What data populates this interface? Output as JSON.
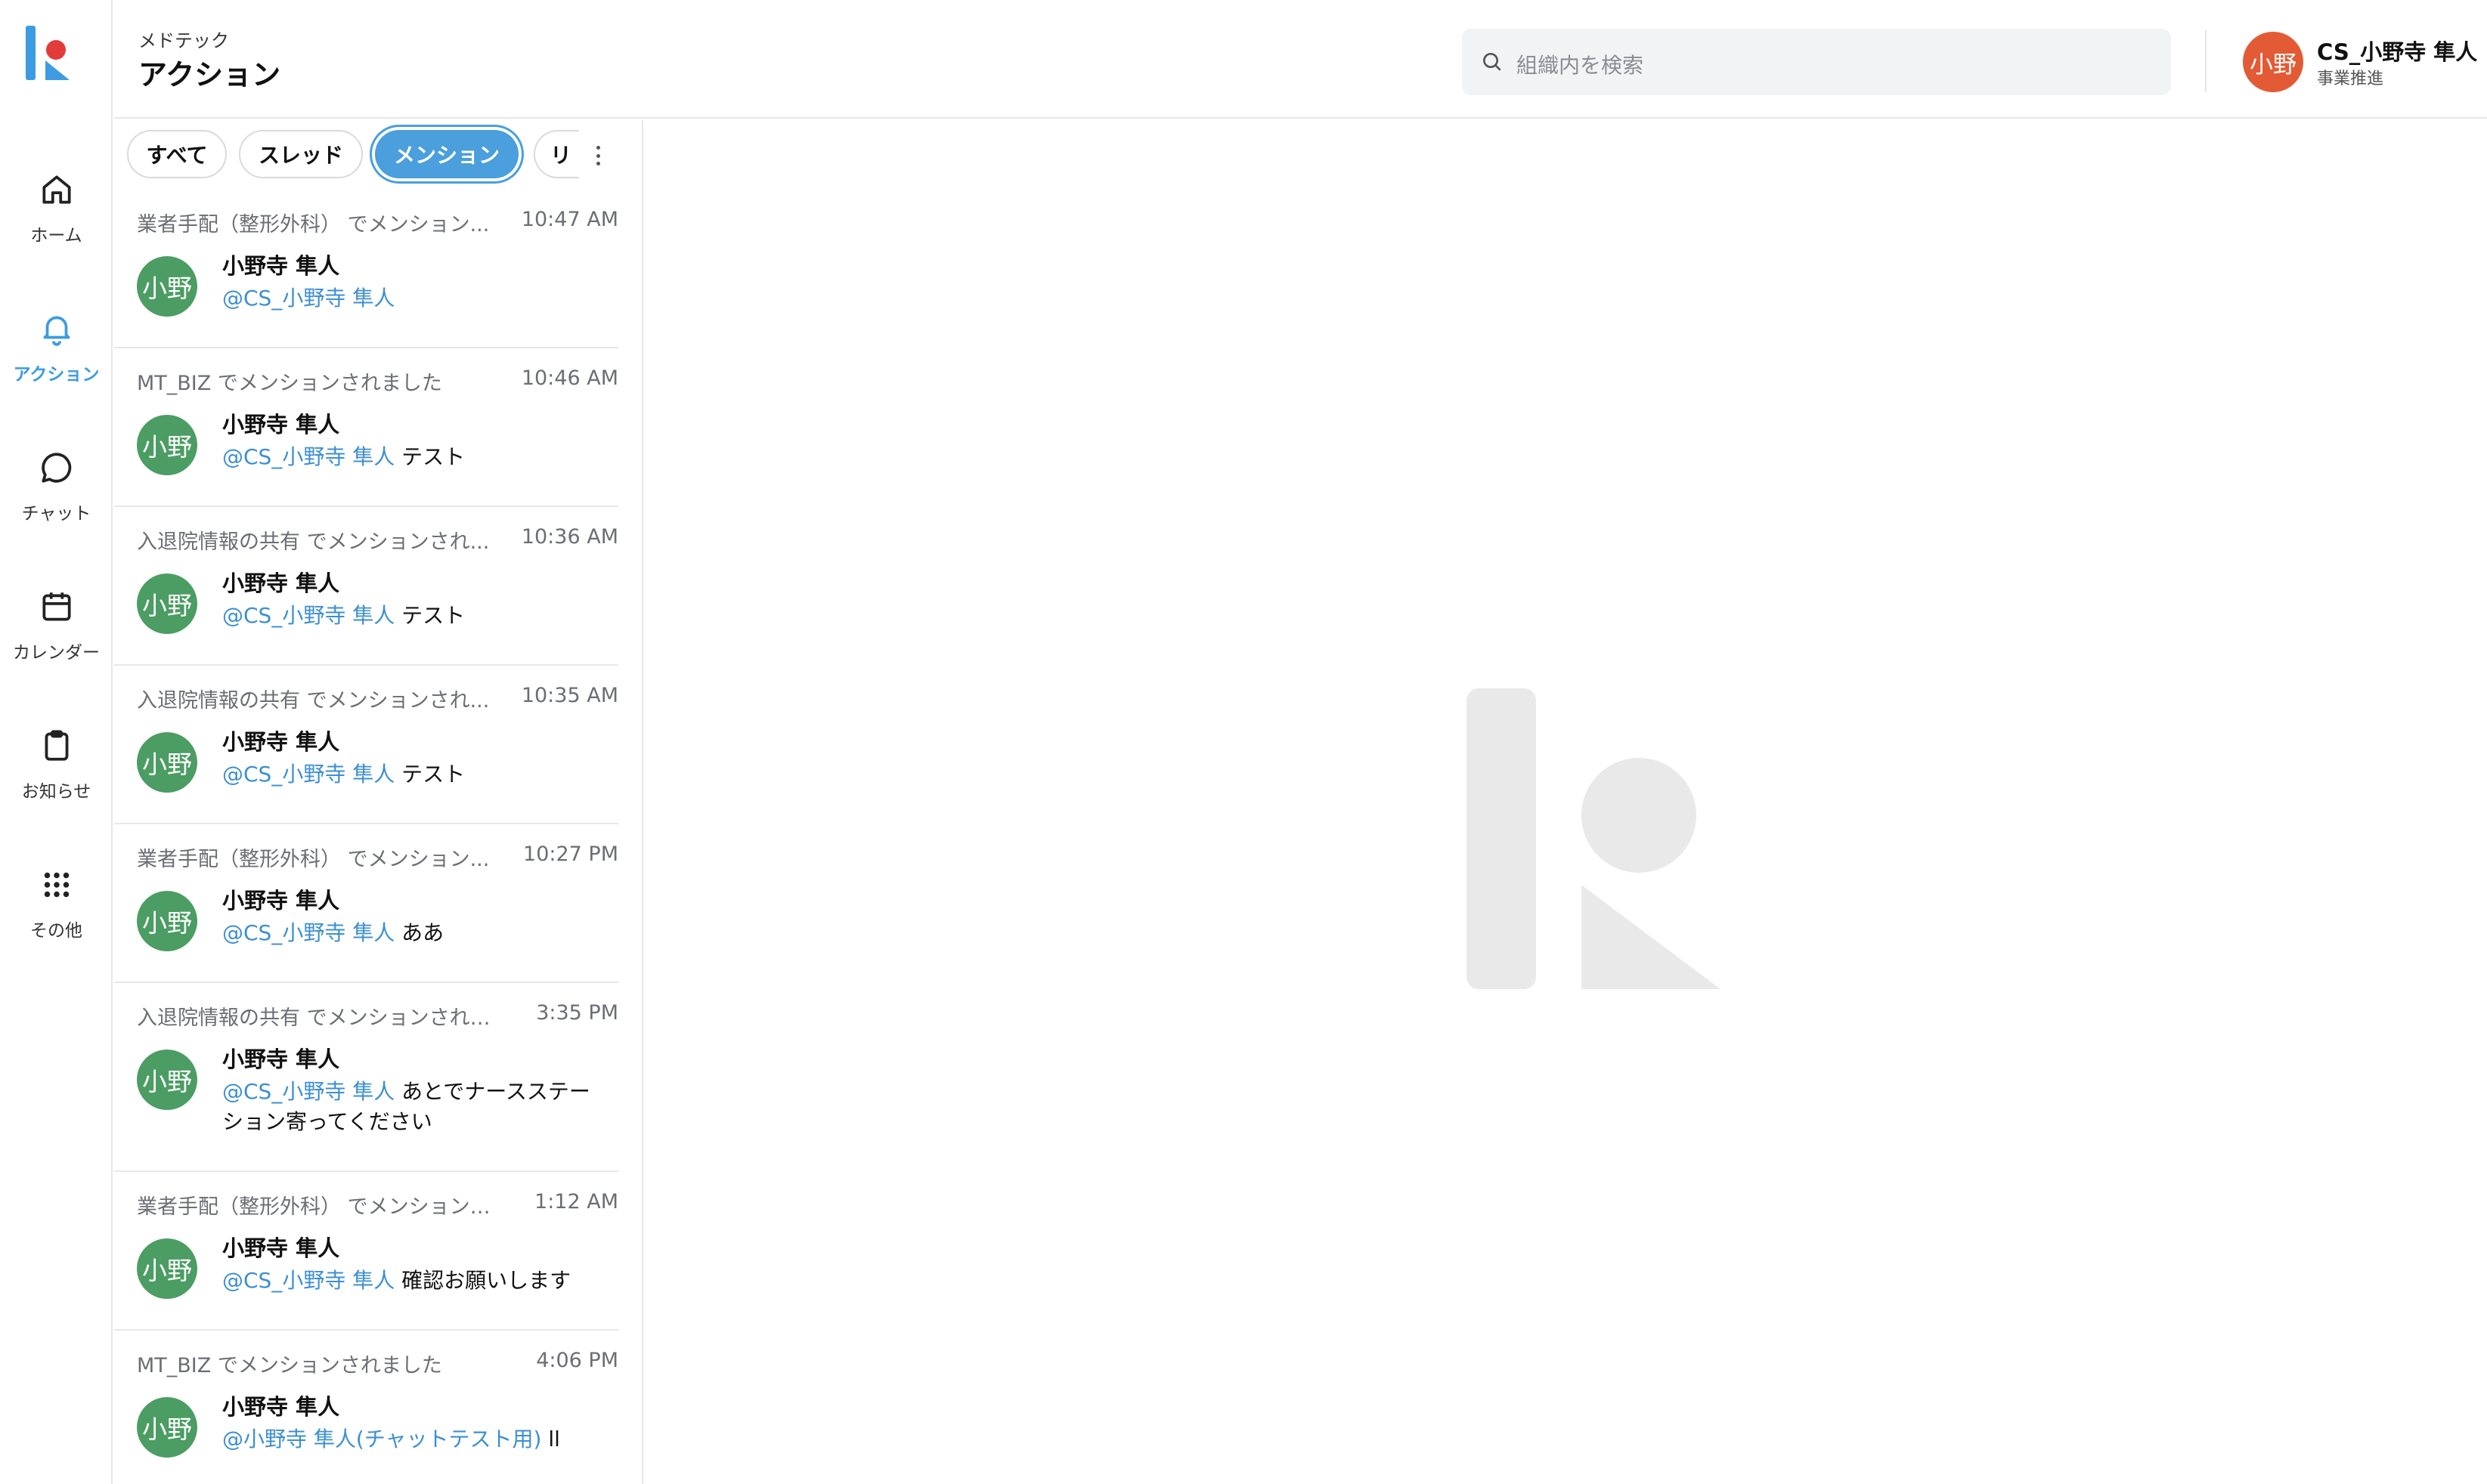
{
  "nav": {
    "items": [
      {
        "label": "ホーム",
        "icon": "home-icon"
      },
      {
        "label": "アクション",
        "icon": "bell-icon",
        "active": true
      },
      {
        "label": "チャット",
        "icon": "chat-bubble-icon"
      },
      {
        "label": "カレンダー",
        "icon": "calendar-icon"
      },
      {
        "label": "お知らせ",
        "icon": "clipboard-icon"
      },
      {
        "label": "その他",
        "icon": "grid-dots-icon"
      }
    ],
    "accent_color": "#3d9be1"
  },
  "header": {
    "org": "メドテック",
    "title": "アクション",
    "search_placeholder": "組織内を検索",
    "user": {
      "avatar_text": "小野",
      "name": "CS_小野寺 隼人",
      "department": "事業推進",
      "avatar_color": "#e25b35"
    }
  },
  "tabs": [
    {
      "label": "すべて"
    },
    {
      "label": "スレッド"
    },
    {
      "label": "メンション",
      "active": true
    },
    {
      "label": "リ"
    }
  ],
  "mentions": [
    {
      "context": "業者手配（整形外科） でメンション...",
      "time": "10:47 AM",
      "avatar": "小野",
      "sender": "小野寺 隼人",
      "mention": "@CS_小野寺 隼人",
      "text": ""
    },
    {
      "context": "MT_BIZ でメンションされました",
      "time": "10:46 AM",
      "avatar": "小野",
      "sender": "小野寺 隼人",
      "mention": "@CS_小野寺 隼人",
      "text": " テスト"
    },
    {
      "context": "入退院情報の共有 でメンションされ...",
      "time": "10:36 AM",
      "avatar": "小野",
      "sender": "小野寺 隼人",
      "mention": "@CS_小野寺 隼人",
      "text": " テスト"
    },
    {
      "context": "入退院情報の共有 でメンションされ...",
      "time": "10:35 AM",
      "avatar": "小野",
      "sender": "小野寺 隼人",
      "mention": "@CS_小野寺 隼人",
      "text": " テスト"
    },
    {
      "context": "業者手配（整形外科） でメンション...",
      "time": "10:27 PM",
      "avatar": "小野",
      "sender": "小野寺 隼人",
      "mention": "@CS_小野寺 隼人",
      "text": " ああ"
    },
    {
      "context": "入退院情報の共有 でメンションされま...",
      "time": "3:35 PM",
      "avatar": "小野",
      "sender": "小野寺 隼人",
      "mention": "@CS_小野寺 隼人",
      "text": " あとでナースステーション寄ってください"
    },
    {
      "context": "業者手配（整形外科） でメンションさ...",
      "time": "1:12 AM",
      "avatar": "小野",
      "sender": "小野寺 隼人",
      "mention": "@CS_小野寺 隼人",
      "text": " 確認お願いします"
    },
    {
      "context": "MT_BIZ でメンションされました",
      "time": "4:06 PM",
      "avatar": "小野",
      "sender": "小野寺 隼人",
      "mention": "@小野寺 隼人(チャットテスト用)",
      "text": " ll"
    }
  ],
  "colors": {
    "mention_avatar": "#4c9d63",
    "mention_link": "#3d8fd1",
    "active_tab": "#4a9fdc"
  }
}
